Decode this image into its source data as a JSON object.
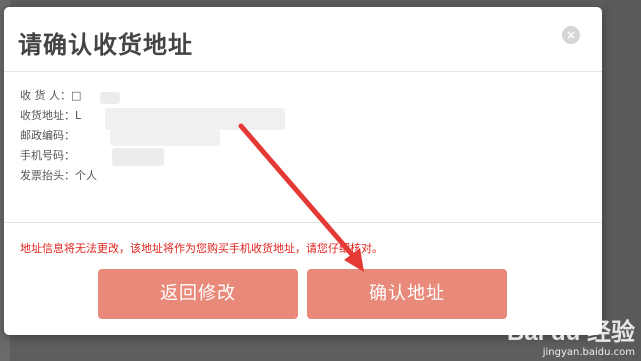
{
  "dialog": {
    "title": "请确认收货地址",
    "close_glyph": "×"
  },
  "address": {
    "rows": [
      {
        "label": "收 货 人：",
        "value": "□"
      },
      {
        "label": "收货地址：",
        "value": "L"
      },
      {
        "label": "邮政编码：",
        "value": ""
      },
      {
        "label": "手机号码：",
        "value": ""
      },
      {
        "label": "发票抬头：",
        "value": "个人"
      }
    ]
  },
  "warning": "地址信息将无法更改，该地址将作为您购买手机收货地址，请您仔细核对。",
  "buttons": {
    "back_label": "返回修改",
    "confirm_label": "确认地址"
  },
  "watermark": {
    "logo": "Bai du 经验",
    "url": "jingyan.baidu.com"
  },
  "colors": {
    "accent_button": "#e8897a",
    "warning_text": "#e0231d",
    "arrow": "#e53935"
  }
}
